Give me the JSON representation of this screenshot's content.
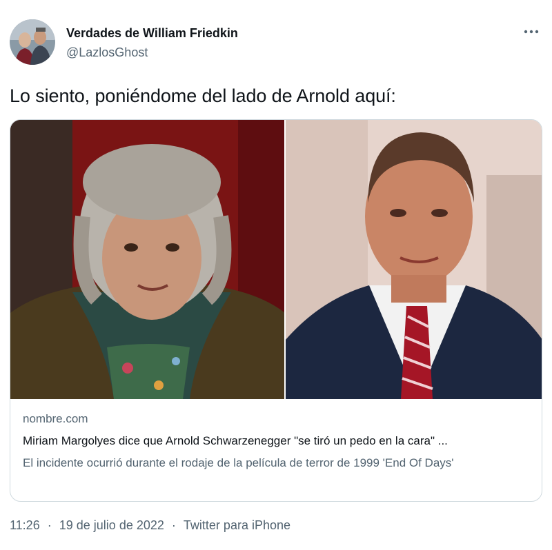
{
  "author": {
    "name": "Verdades de William Friedkin",
    "handle": "@LazlosGhost",
    "avatar_icon": "avatar-photo"
  },
  "more_icon": "more-horizontal-icon",
  "tweet": {
    "text": "Lo siento, poniéndome del lado de Arnold aquí:"
  },
  "card": {
    "domain": "nombre.com",
    "title": "Miriam Margolyes dice que Arnold Schwarzenegger \"se tiró un pedo en la cara\" ...",
    "description": "El incidente ocurrió durante el rodaje de la película de terror de 1999 'End Of Days'"
  },
  "meta": {
    "time": "11:26",
    "date": "19 de julio de 2022",
    "separator": "·",
    "source": "Twitter para iPhone"
  }
}
